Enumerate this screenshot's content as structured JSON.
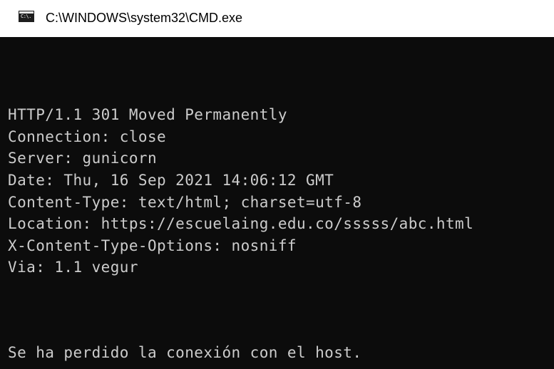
{
  "window": {
    "title": "C:\\WINDOWS\\system32\\CMD.exe",
    "icon": "cmd-console-icon",
    "icon_text": "C:\\."
  },
  "terminal": {
    "lines": [
      "HTTP/1.1 301 Moved Permanently",
      "Connection: close",
      "Server: gunicorn",
      "Date: Thu, 16 Sep 2021 14:06:12 GMT",
      "Content-Type: text/html; charset=utf-8",
      "Location: https://escuelaing.edu.co/sssss/abc.html",
      "X-Content-Type-Options: nosniff",
      "Via: 1.1 vegur"
    ],
    "message": "Se ha perdido la conexión con el host."
  },
  "colors": {
    "background": "#0c0c0c",
    "text": "#cccccc",
    "titlebar": "#ffffff"
  }
}
